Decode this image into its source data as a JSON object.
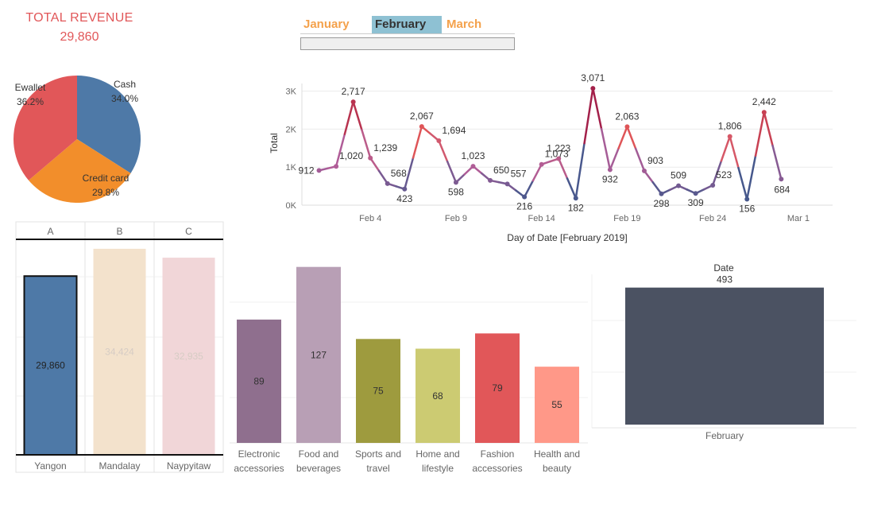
{
  "kpi": {
    "title": "TOTAL REVENUE",
    "value": "29,860"
  },
  "month_filter": {
    "tabs": [
      {
        "label": "January",
        "active": false
      },
      {
        "label": "February",
        "active": true
      },
      {
        "label": "March",
        "active": false
      }
    ]
  },
  "colors": {
    "blue": "#4e79a7",
    "orange": "#f28e2b",
    "red": "#e15759",
    "beige": "#f3e2cc",
    "pink": "#f1d6d8",
    "dark": "#4b5262",
    "highlight_tab": "#8ec1d3",
    "kpi": "#e15759"
  },
  "chart_data": [
    {
      "type": "pie",
      "title": "",
      "slices": [
        {
          "label": "Cash",
          "percent": 34.0,
          "display": "34.0%",
          "color": "#4e79a7"
        },
        {
          "label": "Credit card",
          "percent": 29.8,
          "display": "29.8%",
          "color": "#f28e2b"
        },
        {
          "label": "Ewallet",
          "percent": 36.2,
          "display": "36.2%",
          "color": "#e15759"
        }
      ]
    },
    {
      "type": "line",
      "xlabel": "Day of Date [February 2019]",
      "ylabel": "Total",
      "x_ticks": [
        "Feb 4",
        "Feb 9",
        "Feb 14",
        "Feb 19",
        "Feb 24",
        "Mar 1"
      ],
      "y_ticks": [
        "0K",
        "1K",
        "2K",
        "3K"
      ],
      "ylim": [
        0,
        3200
      ],
      "xlim": [
        "2019-01-31",
        "2019-03-03"
      ],
      "x": [
        "2019-02-01",
        "2019-02-02",
        "2019-02-03",
        "2019-02-04",
        "2019-02-05",
        "2019-02-06",
        "2019-02-07",
        "2019-02-08",
        "2019-02-09",
        "2019-02-10",
        "2019-02-11",
        "2019-02-12",
        "2019-02-13",
        "2019-02-14",
        "2019-02-15",
        "2019-02-16",
        "2019-02-17",
        "2019-02-18",
        "2019-02-19",
        "2019-02-20",
        "2019-02-21",
        "2019-02-22",
        "2019-02-23",
        "2019-02-24",
        "2019-02-25",
        "2019-02-26",
        "2019-02-27",
        "2019-02-28"
      ],
      "values": [
        912,
        1020,
        2717,
        1239,
        568,
        423,
        2067,
        1694,
        598,
        1023,
        650,
        557,
        216,
        1073,
        1223,
        182,
        3071,
        932,
        2063,
        903,
        298,
        509,
        309,
        523,
        1806,
        156,
        2442,
        684
      ],
      "labels": [
        "912",
        "1,020",
        "2,717",
        "1,239",
        "568",
        "423",
        "2,067",
        "1,694",
        "598",
        "1,023",
        "650",
        "557",
        "216",
        "1,073",
        "1,223",
        "182",
        "3,071",
        "932",
        "2,063",
        "903",
        "298",
        "509",
        "309",
        "523",
        "1,806",
        "156",
        "2,442",
        "684"
      ]
    },
    {
      "type": "bar",
      "column_headers": [
        "A",
        "B",
        "C"
      ],
      "categories": [
        "Yangon",
        "Mandalay",
        "Naypyitaw"
      ],
      "values": [
        29860,
        34424,
        32935
      ],
      "labels": [
        "29,860",
        "34,424",
        "32,935"
      ],
      "ylim": [
        0,
        36000
      ],
      "selected": "Yangon",
      "colors": [
        "#4e79a7",
        "#f3e2cc",
        "#f1d6d8"
      ]
    },
    {
      "type": "bar",
      "categories": [
        "Electronic accessories",
        "Food and beverages",
        "Sports and travel",
        "Home and lifestyle",
        "Fashion accessories",
        "Health and beauty"
      ],
      "category_lines": [
        [
          "Electronic",
          "accessories"
        ],
        [
          "Food and",
          "beverages"
        ],
        [
          "Sports and",
          "travel"
        ],
        [
          "Home and",
          "lifestyle"
        ],
        [
          "Fashion",
          "accessories"
        ],
        [
          "Health and",
          "beauty"
        ]
      ],
      "values": [
        89,
        127,
        75,
        68,
        79,
        55
      ],
      "ylim": [
        0,
        136
      ],
      "colors": [
        "#8f6f8e",
        "#b89fb5",
        "#9e9b3e",
        "#cccb72",
        "#e15759",
        "#ff9888"
      ]
    },
    {
      "type": "bar",
      "title": "Date",
      "categories": [
        "February"
      ],
      "values": [
        493
      ],
      "ylim": [
        0,
        555
      ],
      "colors": [
        "#4b5262"
      ]
    }
  ]
}
